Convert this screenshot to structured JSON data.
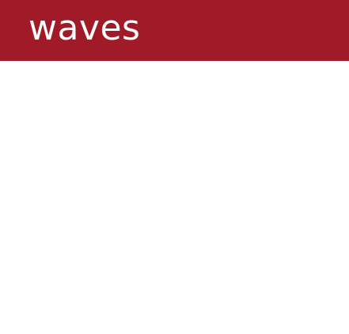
{
  "header": {
    "title": "waves",
    "background_color": "#a01b27",
    "text_color": "#ffffff"
  },
  "content": {
    "background_color": "#ffffff"
  }
}
